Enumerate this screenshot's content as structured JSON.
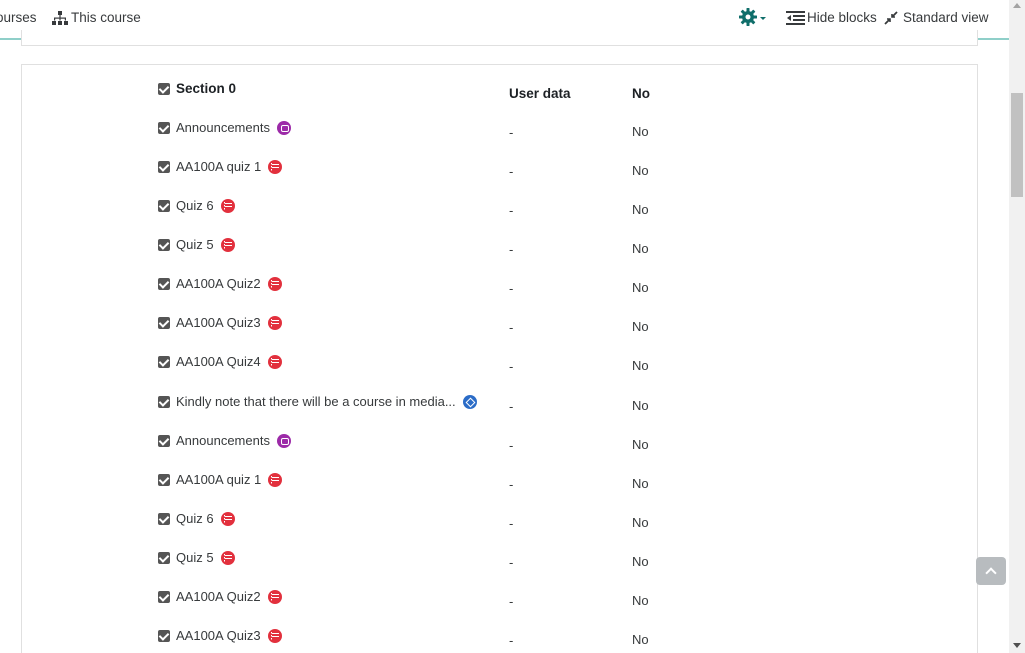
{
  "navbar": {
    "courses_label": "ourses",
    "this_course_label": "This course",
    "hide_blocks_label": "Hide blocks",
    "standard_view_label": "Standard view",
    "accent_color": "#0f6e6a"
  },
  "section": {
    "title": "Section 0",
    "col_user_data": "User data",
    "col_no": "No"
  },
  "rows": [
    {
      "name": "Announcements",
      "icon": "forum-icon",
      "user_data": "-",
      "value": "No"
    },
    {
      "name": "AA100A quiz 1",
      "icon": "quiz-icon",
      "user_data": "-",
      "value": "No"
    },
    {
      "name": "Quiz 6",
      "icon": "quiz-icon",
      "user_data": "-",
      "value": "No"
    },
    {
      "name": "Quiz 5",
      "icon": "quiz-icon",
      "user_data": "-",
      "value": "No"
    },
    {
      "name": "AA100A Quiz2",
      "icon": "quiz-icon",
      "user_data": "-",
      "value": "No"
    },
    {
      "name": "AA100A Quiz3",
      "icon": "quiz-icon",
      "user_data": "-",
      "value": "No"
    },
    {
      "name": "AA100A Quiz4",
      "icon": "quiz-icon",
      "user_data": "-",
      "value": "No"
    },
    {
      "name": "Kindly note that there will be a course in media...",
      "icon": "label-icon",
      "user_data": "-",
      "value": "No"
    },
    {
      "name": "Announcements",
      "icon": "forum-icon",
      "user_data": "-",
      "value": "No"
    },
    {
      "name": "AA100A quiz 1",
      "icon": "quiz-icon",
      "user_data": "-",
      "value": "No"
    },
    {
      "name": "Quiz 6",
      "icon": "quiz-icon",
      "user_data": "-",
      "value": "No"
    },
    {
      "name": "Quiz 5",
      "icon": "quiz-icon",
      "user_data": "-",
      "value": "No"
    },
    {
      "name": "AA100A Quiz2",
      "icon": "quiz-icon",
      "user_data": "-",
      "value": "No"
    },
    {
      "name": "AA100A Quiz3",
      "icon": "quiz-icon",
      "user_data": "-",
      "value": "No"
    }
  ]
}
